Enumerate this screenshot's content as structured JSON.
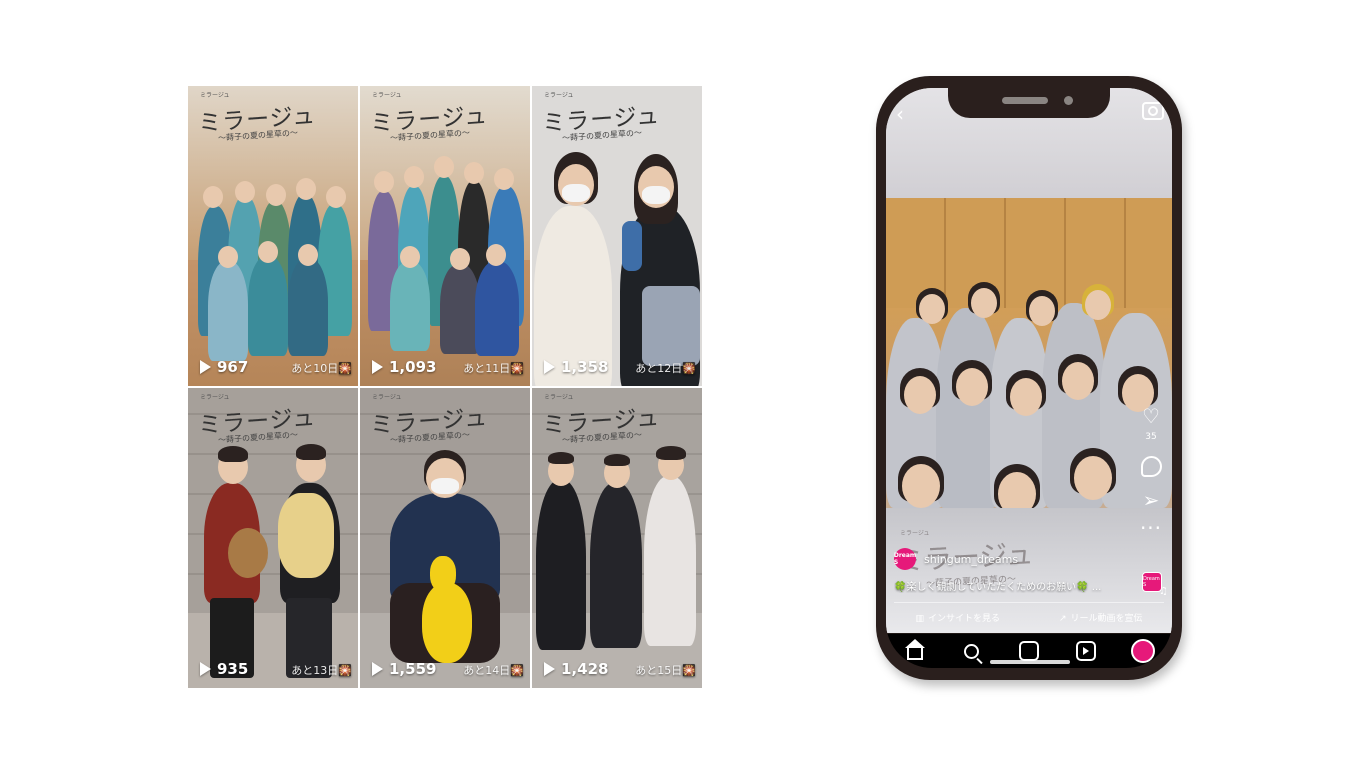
{
  "grid": {
    "tiles": [
      {
        "views": "967",
        "countdown": "あと10日🎇",
        "title": "ミラージュ",
        "subtitle": "～蒔子の夏の星草の～",
        "small": "ミラージュ",
        "bg": "#c7a27a",
        "floor": "#b98a5c"
      },
      {
        "views": "1,093",
        "countdown": "あと11日🎇",
        "title": "ミラージュ",
        "subtitle": "～蒔子の夏の星草の～",
        "small": "ミラージュ",
        "bg": "#c9ab86",
        "floor": "#b38a60"
      },
      {
        "views": "1,358",
        "countdown": "あと12日🎇",
        "title": "ミラージュ",
        "subtitle": "～蒔子の夏の星草の～",
        "small": "ミラージュ",
        "bg": "#dcdad8",
        "floor": "#cfcccb"
      },
      {
        "views": "935",
        "countdown": "あと13日🎇",
        "title": "ミラージュ",
        "subtitle": "～蒔子の夏の星草の～",
        "small": "ミラージュ",
        "bg": "#a8a29c",
        "floor": "#b6b0aa"
      },
      {
        "views": "1,559",
        "countdown": "あと14日🎇",
        "title": "ミラージュ",
        "subtitle": "～蒔子の夏の星草の～",
        "small": "ミラージュ",
        "bg": "#a39e99",
        "floor": "#b2ada8"
      },
      {
        "views": "1,428",
        "countdown": "あと15日🎇",
        "title": "ミラージュ",
        "subtitle": "～蒔子の夏の星草の～",
        "small": "ミラージュ",
        "bg": "#a6a19c",
        "floor": "#b4afaa"
      }
    ]
  },
  "phone": {
    "username": "shingum_dreams",
    "avatar_text": "Dream S",
    "caption": "🍀楽しく観劇していただくためのお願い🍀 ...",
    "likes": "35",
    "overlay_title": "ミラージュ",
    "overlay_subtitle": "～蒔子の夏の星草の～",
    "overlay_small": "ミラージュ",
    "insights_label": "インサイトを見る",
    "promote_label": "リール動画を宣伝",
    "music_thumb_text": "Dream S",
    "colors": {
      "brand": "#e6197a",
      "frame": "#2a1f1d"
    }
  }
}
